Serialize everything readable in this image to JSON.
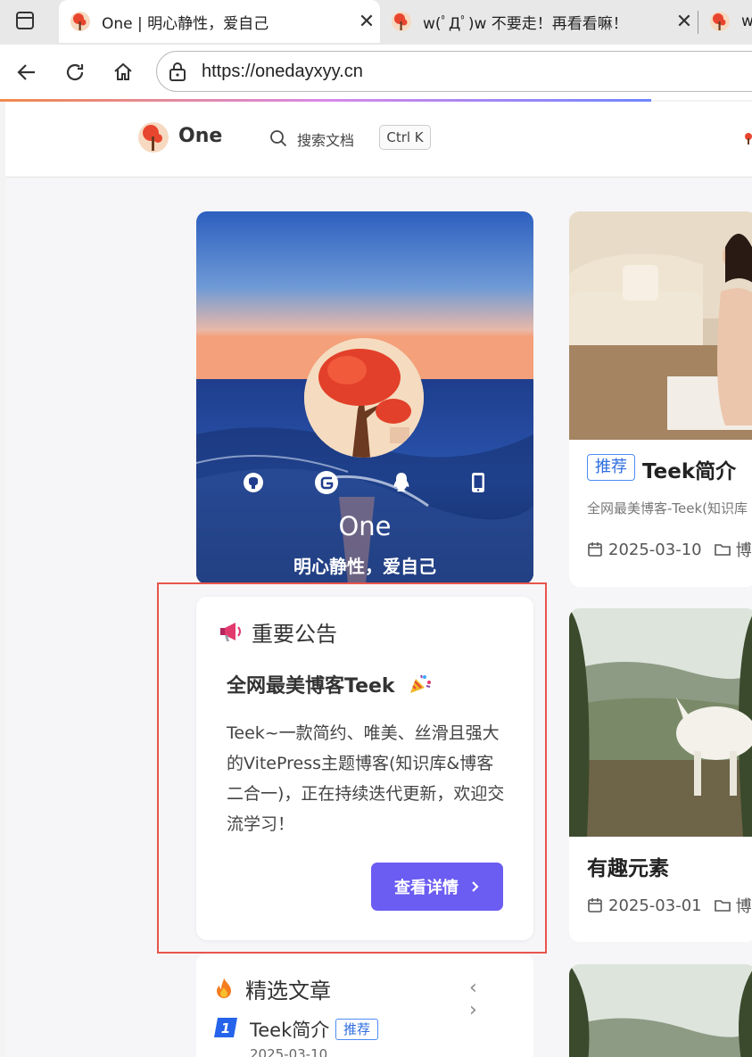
{
  "browser": {
    "tabs": [
      {
        "title": "One | 明心静性，爱自己",
        "active": true
      },
      {
        "title": "w(ﾟДﾟ)w 不要走！再看看嘛！",
        "active": false
      },
      {
        "title": "w",
        "active": false
      }
    ],
    "close_glyph": "✕",
    "url": "https://onedayxyy.cn"
  },
  "header": {
    "site_name": "One",
    "search_placeholder": "搜索文档",
    "search_shortcut": "Ctrl K"
  },
  "profile": {
    "name": "One",
    "motto": "明心静性，爱自己",
    "socials": [
      "github-icon",
      "gitee-icon",
      "qq-icon",
      "mobile-icon"
    ]
  },
  "notice": {
    "heading": "重要公告",
    "title": "全网最美博客Teek",
    "body": "Teek~一款简约、唯美、丝滑且强大的VitePress主题博客(知识库&博客二合一)，正在持续迭代更新，欢迎交流学习！",
    "button_label": "查看详情",
    "highlight_color": "#e9554b"
  },
  "featured": {
    "heading": "精选文章",
    "arrows": "‹ ›",
    "items": [
      {
        "rank": "1",
        "title": "Teek简介",
        "tag": "推荐",
        "date": "2025-03-10"
      }
    ]
  },
  "posts": [
    {
      "tag": "推荐",
      "title": "Teek简介",
      "desc": "全网最美博客-Teek(知识库",
      "date": "2025-03-10",
      "category": "博客"
    },
    {
      "title": "有趣元素",
      "date": "2025-03-01",
      "category": "博客"
    }
  ],
  "colors": {
    "accent": "#6b5cf2",
    "tag_blue": "#2f6ee0"
  }
}
